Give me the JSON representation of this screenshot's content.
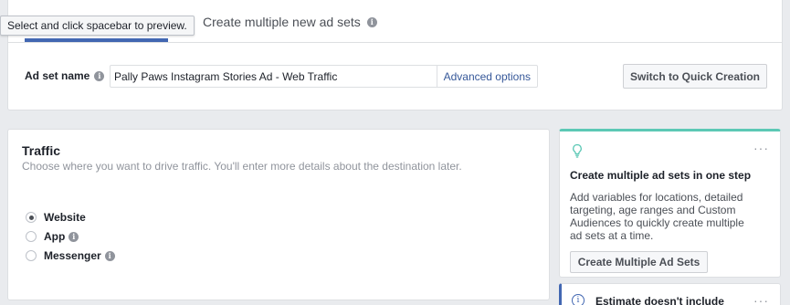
{
  "tooltip": {
    "text": "Select and click spacebar to preview."
  },
  "header": {
    "tab_create_multiple": "Create multiple new ad sets"
  },
  "adset": {
    "label": "Ad set name",
    "name_value": "Pally Paws Instagram Stories Ad - Web Traffic",
    "advanced_options": "Advanced options",
    "switch_button": "Switch to Quick Creation"
  },
  "traffic": {
    "title": "Traffic",
    "description": "Choose where you want to drive traffic. You'll enter more details about the destination later.",
    "options": [
      {
        "label": "Website",
        "selected": true
      },
      {
        "label": "App",
        "selected": false
      },
      {
        "label": "Messenger",
        "selected": false
      }
    ]
  },
  "tip": {
    "title": "Create multiple ad sets in one step",
    "body": "Add variables for locations, detailed targeting, age ranges and Custom Audiences to quickly create multiple ad sets at a time.",
    "button": "Create Multiple Ad Sets",
    "more": "···"
  },
  "estimate": {
    "title": "Estimate doesn't include",
    "more": "···"
  },
  "icons": {
    "info": "info-icon",
    "bulb": "lightbulb-icon",
    "more": "more-options-icon"
  },
  "colors": {
    "accent": "#4267b2",
    "tip_border": "#5cc8b5",
    "link": "#365899",
    "background": "#e9ebee"
  }
}
